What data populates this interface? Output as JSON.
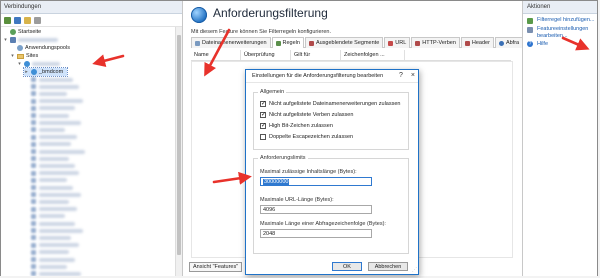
{
  "connections": {
    "title": "Verbindungen",
    "tree": {
      "start_page": "Startseite",
      "app_pools": "Anwendungspools",
      "sites": "Sites",
      "selected_site": "_bmdcom"
    }
  },
  "feature": {
    "title": "Anforderungsfilterung",
    "description": "Mit diesem Feature können Sie Filterregeln konfigurieren.",
    "tabs": [
      {
        "label": "Dateinamenerweiterungen",
        "active": false
      },
      {
        "label": "Regeln",
        "active": true
      },
      {
        "label": "Ausgeblendete Segmente",
        "active": false
      },
      {
        "label": "URL",
        "active": false
      },
      {
        "label": "HTTP-Verben",
        "active": false
      },
      {
        "label": "Header",
        "active": false
      },
      {
        "label": "Abfra",
        "active": false
      }
    ],
    "columns": [
      "Name",
      "Überprüfung",
      "Gilt für",
      "Zeichenfolgen ..."
    ],
    "view_button": "Ansicht \"Features\""
  },
  "actions": {
    "title": "Aktionen",
    "links": [
      "Filterregel hinzufügen...",
      "Featureeinstellungen bearbeiten...",
      "Hilfe"
    ]
  },
  "dialog": {
    "title": "Einstellungen für die Anforderungsfilterung bearbeiten",
    "help_btn": "?",
    "close_btn": "×",
    "general": {
      "label": "Allgemein",
      "checkboxes": [
        {
          "label": "Nicht aufgelistete Dateinamenerweiterungen zulassen",
          "checked": true
        },
        {
          "label": "Nicht aufgelistete Verben zulassen",
          "checked": true
        },
        {
          "label": "High Bit-Zeichen zulassen",
          "checked": true
        },
        {
          "label": "Doppelte Escapezeichen zulassen",
          "checked": false
        }
      ]
    },
    "limits": {
      "label": "Anforderungslimits",
      "content_length_label": "Maximal zulässige Inhaltslänge (Bytes):",
      "content_length_value": "30000000",
      "url_length_label": "Maximale URL-Länge (Bytes):",
      "url_length_value": "4096",
      "query_length_label": "Maximale Länge einer Abfragezeichenfolge (Bytes):",
      "query_length_value": "2048"
    },
    "ok": "OK",
    "cancel": "Abbrechen"
  },
  "colors": {
    "annotation_red": "#e8322b",
    "accent_blue": "#1f72c7",
    "link_blue": "#1a5cb0"
  }
}
